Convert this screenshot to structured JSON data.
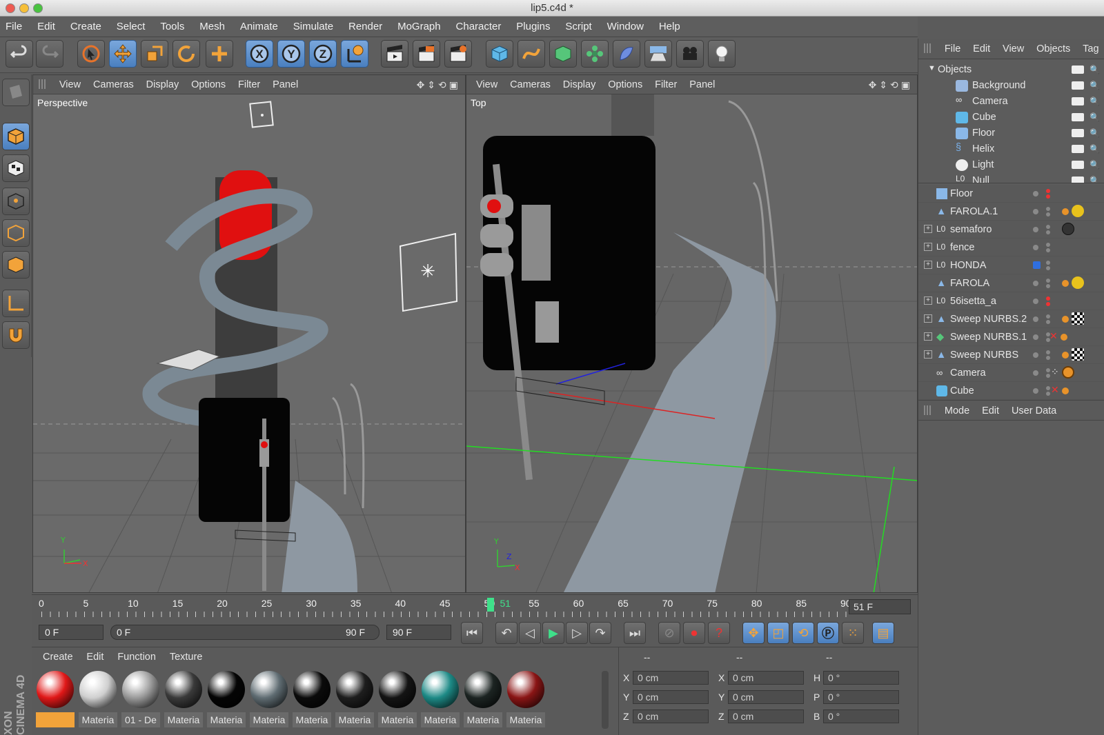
{
  "window": {
    "title": "lip5.c4d *"
  },
  "menubar": [
    "File",
    "Edit",
    "Create",
    "Select",
    "Tools",
    "Mesh",
    "Animate",
    "Simulate",
    "Render",
    "MoGraph",
    "Character",
    "Plugins",
    "Script",
    "Window",
    "Help"
  ],
  "viewport_left": {
    "menu": [
      "View",
      "Cameras",
      "Display",
      "Options",
      "Filter",
      "Panel"
    ],
    "label": "Perspective"
  },
  "viewport_right": {
    "menu": [
      "View",
      "Cameras",
      "Display",
      "Options",
      "Filter",
      "Panel"
    ],
    "label": "Top"
  },
  "object_manager": {
    "menu": [
      "File",
      "Edit",
      "View",
      "Objects",
      "Tag"
    ],
    "root": "Objects",
    "items": [
      "Background",
      "Camera",
      "Cube",
      "Floor",
      "Helix",
      "Light",
      "Null"
    ]
  },
  "hierarchy": {
    "rows": [
      "Floor",
      "FAROLA.1",
      "semaforo",
      "fence",
      "HONDA",
      "FAROLA",
      "56isetta_a",
      "Sweep NURBS.2",
      "Sweep NURBS.1",
      "Sweep NURBS",
      "Camera",
      "Cube"
    ]
  },
  "attributes": {
    "menu": [
      "Mode",
      "Edit",
      "User Data"
    ]
  },
  "timeline": {
    "ticks": [
      "0",
      "5",
      "10",
      "15",
      "20",
      "25",
      "30",
      "35",
      "40",
      "45",
      "50",
      "51",
      "55",
      "60",
      "65",
      "70",
      "75",
      "80",
      "85",
      "90"
    ],
    "current_frame_display": "51 F",
    "current_frame": 51,
    "max_frame": 90
  },
  "transport": {
    "start": "0 F",
    "range_start": "0 F",
    "range_end": "90 F",
    "end": "90 F"
  },
  "material_manager": {
    "menu": [
      "Create",
      "Edit",
      "Function",
      "Texture"
    ],
    "materials": [
      {
        "label": "",
        "color": "#e01818"
      },
      {
        "label": "Materia",
        "color": "#cfcfcf"
      },
      {
        "label": "01 - De",
        "color": "#9a9a9a"
      },
      {
        "label": "Materia",
        "color": "#3a3a3a"
      },
      {
        "label": "Materia",
        "color": "#050505"
      },
      {
        "label": "Materia",
        "color": "#5f6c72"
      },
      {
        "label": "Materia",
        "color": "#0b0b0b"
      },
      {
        "label": "Materia",
        "color": "#1e1e1e"
      },
      {
        "label": "Materia",
        "color": "#141414"
      },
      {
        "label": "Materia",
        "color": "#1d8a86"
      },
      {
        "label": "Materia",
        "color": "#1c2422"
      },
      {
        "label": "Materia",
        "color": "#8a1515"
      }
    ]
  },
  "coordinates": {
    "headers": [
      "--",
      "--",
      "--"
    ],
    "rows": [
      {
        "a": "X",
        "av": "0 cm",
        "b": "X",
        "bv": "0 cm",
        "c": "H",
        "cv": "0 °"
      },
      {
        "a": "Y",
        "av": "0 cm",
        "b": "Y",
        "bv": "0 cm",
        "c": "P",
        "cv": "0 °"
      },
      {
        "a": "Z",
        "av": "0 cm",
        "b": "Z",
        "bv": "0 cm",
        "c": "B",
        "cv": "0 °"
      }
    ]
  },
  "side_logo": "XON CINEMA 4D",
  "colors": {
    "accent": "#4a7fbf",
    "frame_cursor": "#3fe08a",
    "red_light": "#e01818"
  }
}
